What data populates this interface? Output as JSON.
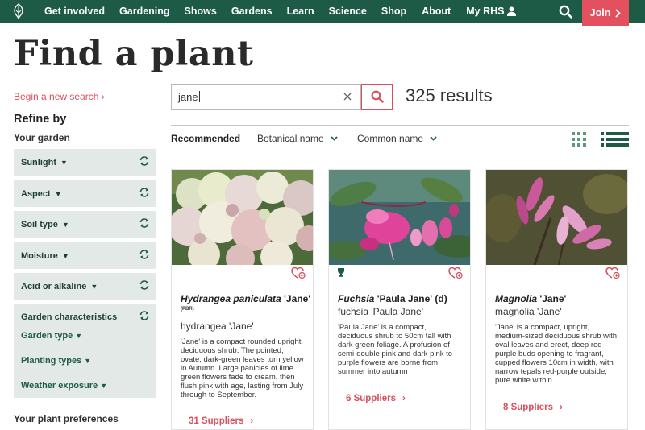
{
  "nav": {
    "items": [
      "Get involved",
      "Gardening",
      "Shows",
      "Gardens",
      "Learn",
      "Science",
      "Shop",
      "About"
    ],
    "my_rhs": "My RHS",
    "join": "Join",
    "logo_icon": "rhs-logo-icon",
    "search_icon": "search-icon",
    "user_icon": "user-icon",
    "bg_color": "#1e5b46",
    "join_color": "#e2515d"
  },
  "page": {
    "title": "Find a plant"
  },
  "sidebar": {
    "begin_search": "Begin a new search",
    "refine_by": "Refine by",
    "your_garden": "Your garden",
    "filters": [
      "Sunlight",
      "Aspect",
      "Soil type",
      "Moisture",
      "Acid or alkaline"
    ],
    "garden_characteristics": "Garden characteristics",
    "garden_subfilters": [
      "Garden type",
      "Planting types",
      "Weather exposure"
    ],
    "your_plant_preferences": "Your plant preferences"
  },
  "search": {
    "value": "jane",
    "results": "325 results"
  },
  "sort": {
    "recommended": "Recommended",
    "botanical": "Botanical name",
    "common": "Common name"
  },
  "cards": [
    {
      "botanical_italic": "Hydrangea paniculata",
      "botanical_rest": " 'Jane'",
      "pbr": "(PBR)",
      "common": "hydrangea 'Jane'",
      "description": "'Jane' is a compact rounded upright deciduous shrub. The pointed, ovate, dark-green leaves turn yellow in Autumn. Large panicles of lime green flowers fade to cream, then flush pink with age, lasting from July through to September.",
      "suppliers": "31 Suppliers",
      "award": false
    },
    {
      "botanical_italic": "Fuchsia",
      "botanical_rest": " 'Paula Jane' (d)",
      "pbr": "",
      "common": "fuchsia 'Paula Jane'",
      "description": "'Paula Jane' is a compact, deciduous shrub to 50cm tall with dark green foliage. A profusion of semi-double pink and dark pink to purple flowers are borne from summer into autumn",
      "suppliers": "6 Suppliers",
      "award": true
    },
    {
      "botanical_italic": "Magnolia",
      "botanical_rest": " 'Jane'",
      "pbr": "",
      "common": "magnolia 'Jane'",
      "description": "'Jane' is a compact, upright, medium-sized deciduous shrub with oval leaves and erect, deep red-purple buds opening to fragrant, cupped flowers 10cm in width, with narrow tepals red-purple outside, pure white within",
      "suppliers": "8 Suppliers",
      "award": false
    }
  ]
}
